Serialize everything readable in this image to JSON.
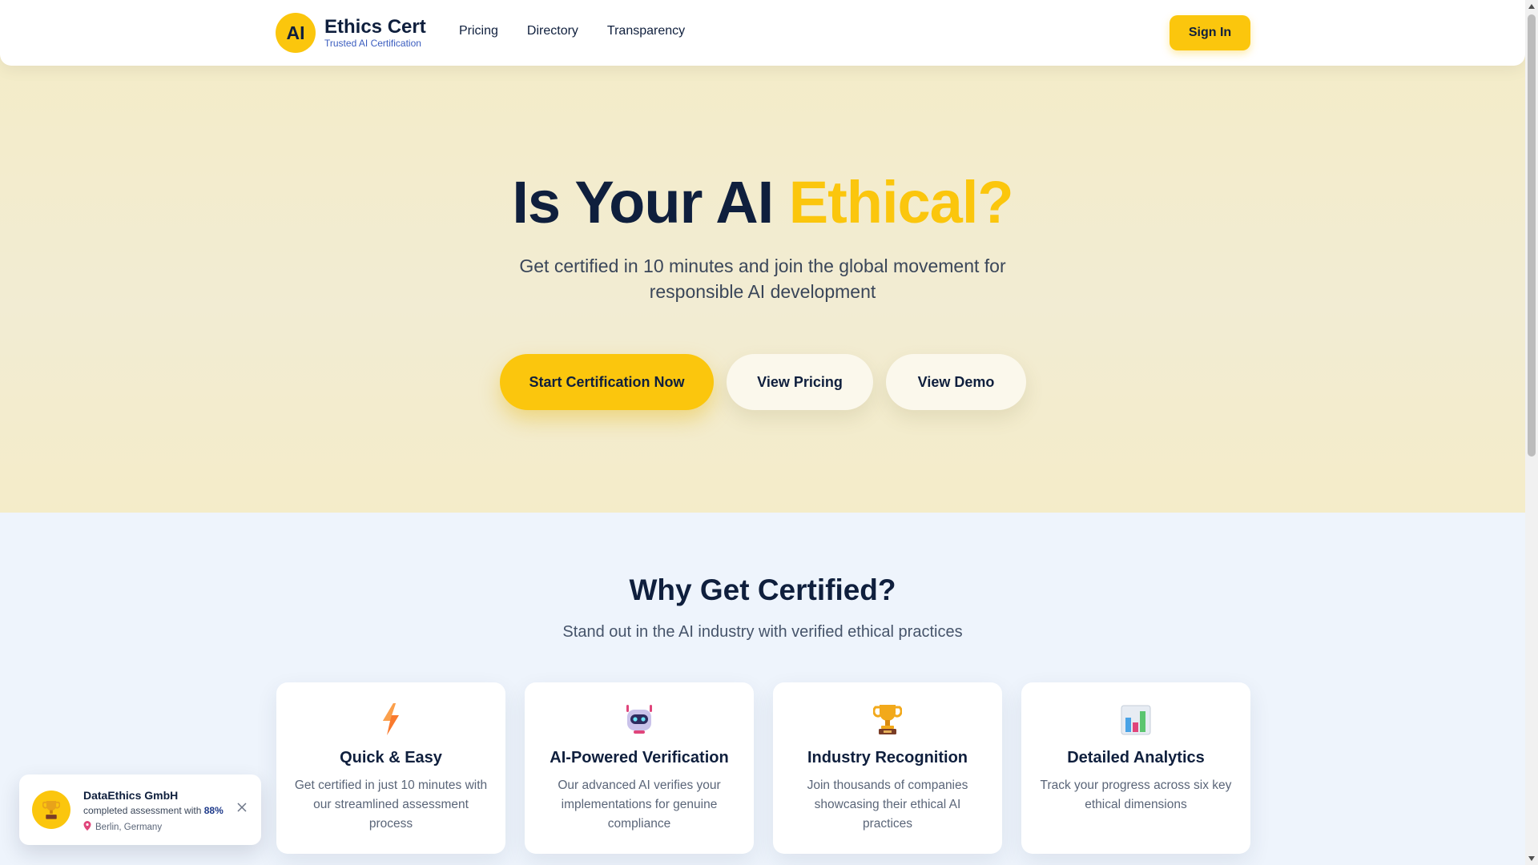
{
  "header": {
    "logo_text": "AI",
    "brand_title": "Ethics Cert",
    "brand_subtitle": "Trusted AI Certification",
    "nav": [
      {
        "label": "Pricing"
      },
      {
        "label": "Directory"
      },
      {
        "label": "Transparency"
      }
    ],
    "signin_label": "Sign In"
  },
  "hero": {
    "title_main": "Is Your AI ",
    "title_accent": "Ethical?",
    "subtitle": "Get certified in 10 minutes and join the global movement for responsible AI development",
    "primary_cta": "Start Certification Now",
    "pricing_cta": "View Pricing",
    "demo_cta": "View Demo"
  },
  "why": {
    "title": "Why Get Certified?",
    "subtitle": "Stand out in the AI industry with verified ethical practices",
    "cards": [
      {
        "icon": "lightning-icon",
        "title": "Quick & Easy",
        "description": "Get certified in just 10 minutes with our streamlined assessment process"
      },
      {
        "icon": "robot-icon",
        "title": "AI-Powered Verification",
        "description": "Our advanced AI verifies your implementations for genuine compliance"
      },
      {
        "icon": "trophy-icon",
        "title": "Industry Recognition",
        "description": "Join thousands of companies showcasing their ethical AI practices"
      },
      {
        "icon": "bar-chart-icon",
        "title": "Detailed Analytics",
        "description": "Track your progress across six key ethical dimensions"
      }
    ]
  },
  "toast": {
    "company": "DataEthics GmbH",
    "message_prefix": "completed assessment with ",
    "score": "88%",
    "location": "Berlin, Germany"
  },
  "colors": {
    "accent": "#fbc60d",
    "navy": "#0f1f3d",
    "hero_bg": "#f3ecce",
    "section_bg": "#eef4fc"
  }
}
